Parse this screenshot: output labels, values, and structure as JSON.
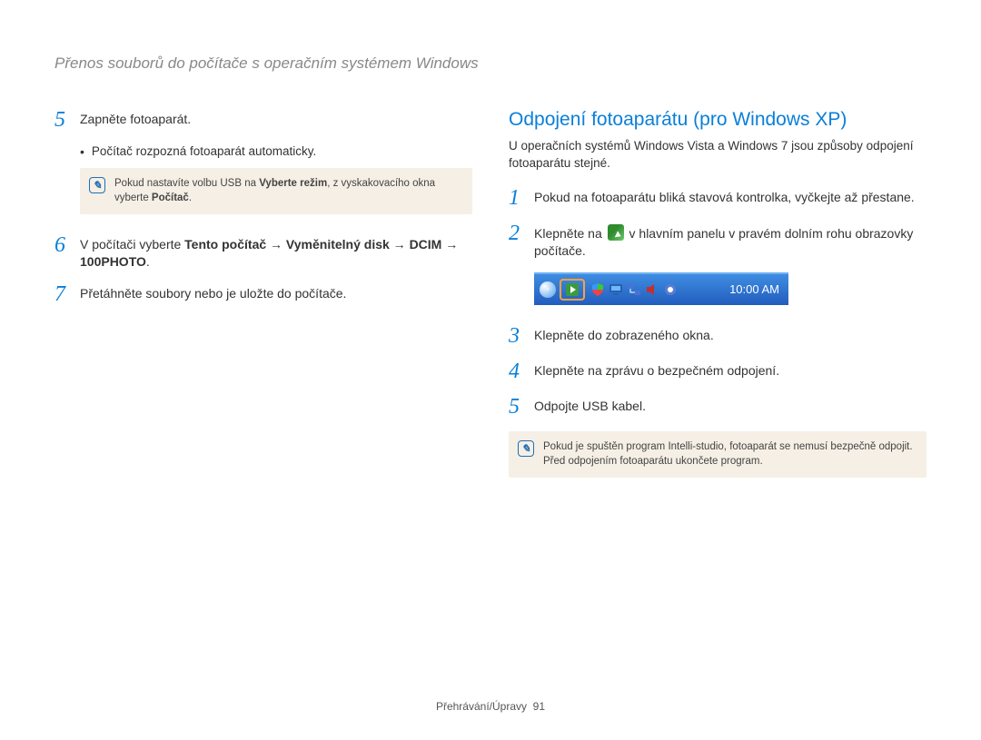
{
  "page_header": "Přenos souborů do počítače s operačním systémem Windows",
  "left": {
    "step5_num": "5",
    "step5_text": "Zapněte fotoaparát.",
    "step5_bullet": "Počítač rozpozná fotoaparát automaticky.",
    "note1_prefix": "Pokud nastavíte volbu USB na ",
    "note1_bold1": "Vyberte režim",
    "note1_mid": ", z vyskakovacího okna vyberte ",
    "note1_bold2": "Počítač",
    "note1_suffix": ".",
    "step6_num": "6",
    "step6_pre": "V počítači vyberte ",
    "step6_b1": "Tento počítač",
    "step6_arrow": " → ",
    "step6_b2": "Vyměnitelný disk",
    "step6_b3": "DCIM",
    "step6_b4": "100PHOTO",
    "step6_dot": ".",
    "step7_num": "7",
    "step7_text": "Přetáhněte soubory nebo je uložte do počítače."
  },
  "right": {
    "heading": "Odpojení fotoaparátu (pro Windows XP)",
    "intro": "U operačních systémů Windows Vista a Windows 7 jsou způsoby odpojení fotoaparátu stejné.",
    "step1_num": "1",
    "step1_text": "Pokud na fotoaparátu bliká stavová kontrolka, vyčkejte až přestane.",
    "step2_num": "2",
    "step2_pre": "Klepněte na ",
    "step2_post": " v hlavním panelu v pravém dolním rohu obrazovky počítače.",
    "tray_clock": "10:00 AM",
    "step3_num": "3",
    "step3_text": "Klepněte do zobrazeného okna.",
    "step4_num": "4",
    "step4_text": "Klepněte na zprávu o bezpečném odpojení.",
    "step5_num": "5",
    "step5_text": "Odpojte USB kabel.",
    "note2": "Pokud je spuštěn program Intelli-studio, fotoaparát se nemusí bezpečně odpojit. Před odpojením fotoaparátu ukončete program."
  },
  "footer_label": "Přehrávání/Úpravy",
  "footer_page": "91"
}
